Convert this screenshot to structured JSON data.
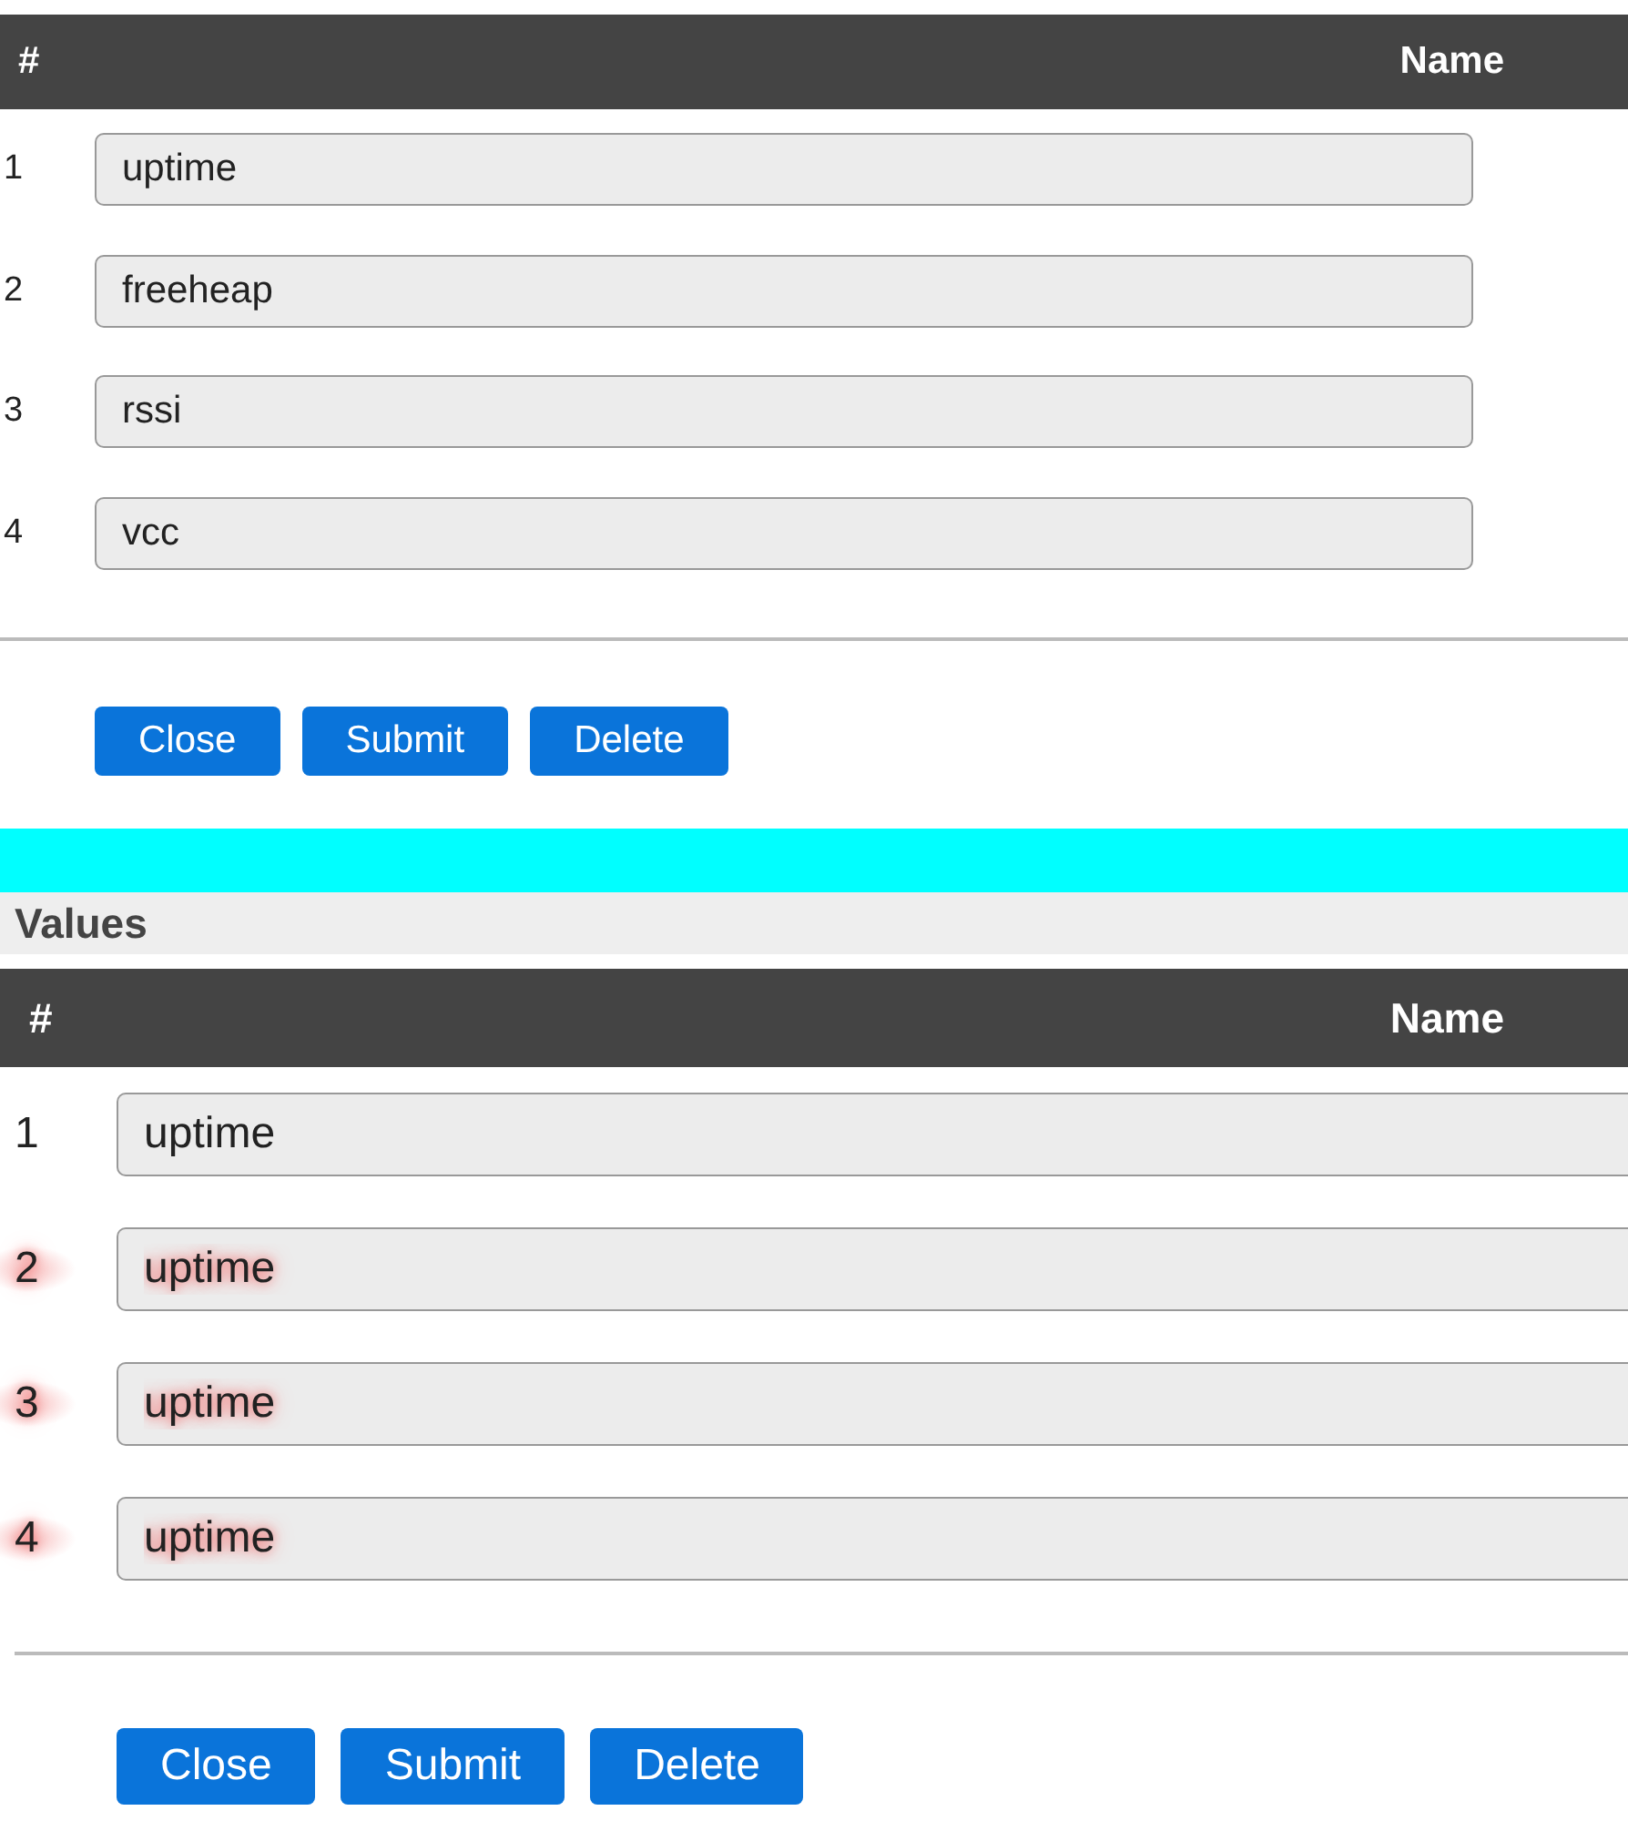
{
  "panels": [
    {
      "columns": [
        "#",
        "Name"
      ],
      "rows": [
        {
          "number": "1",
          "name": "uptime",
          "highlighted": false
        },
        {
          "number": "2",
          "name": "freeheap",
          "highlighted": false
        },
        {
          "number": "3",
          "name": "rssi",
          "highlighted": false
        },
        {
          "number": "4",
          "name": "vcc",
          "highlighted": false
        }
      ],
      "buttons": [
        "Close",
        "Submit",
        "Delete"
      ]
    },
    {
      "title": "Values",
      "columns": [
        "#",
        "Name"
      ],
      "rows": [
        {
          "number": "1",
          "name": "uptime",
          "highlighted": false
        },
        {
          "number": "2",
          "name": "uptime",
          "highlighted": true
        },
        {
          "number": "3",
          "name": "uptime",
          "highlighted": true
        },
        {
          "number": "4",
          "name": "uptime",
          "highlighted": true
        }
      ],
      "buttons": [
        "Close",
        "Submit",
        "Delete"
      ]
    }
  ]
}
